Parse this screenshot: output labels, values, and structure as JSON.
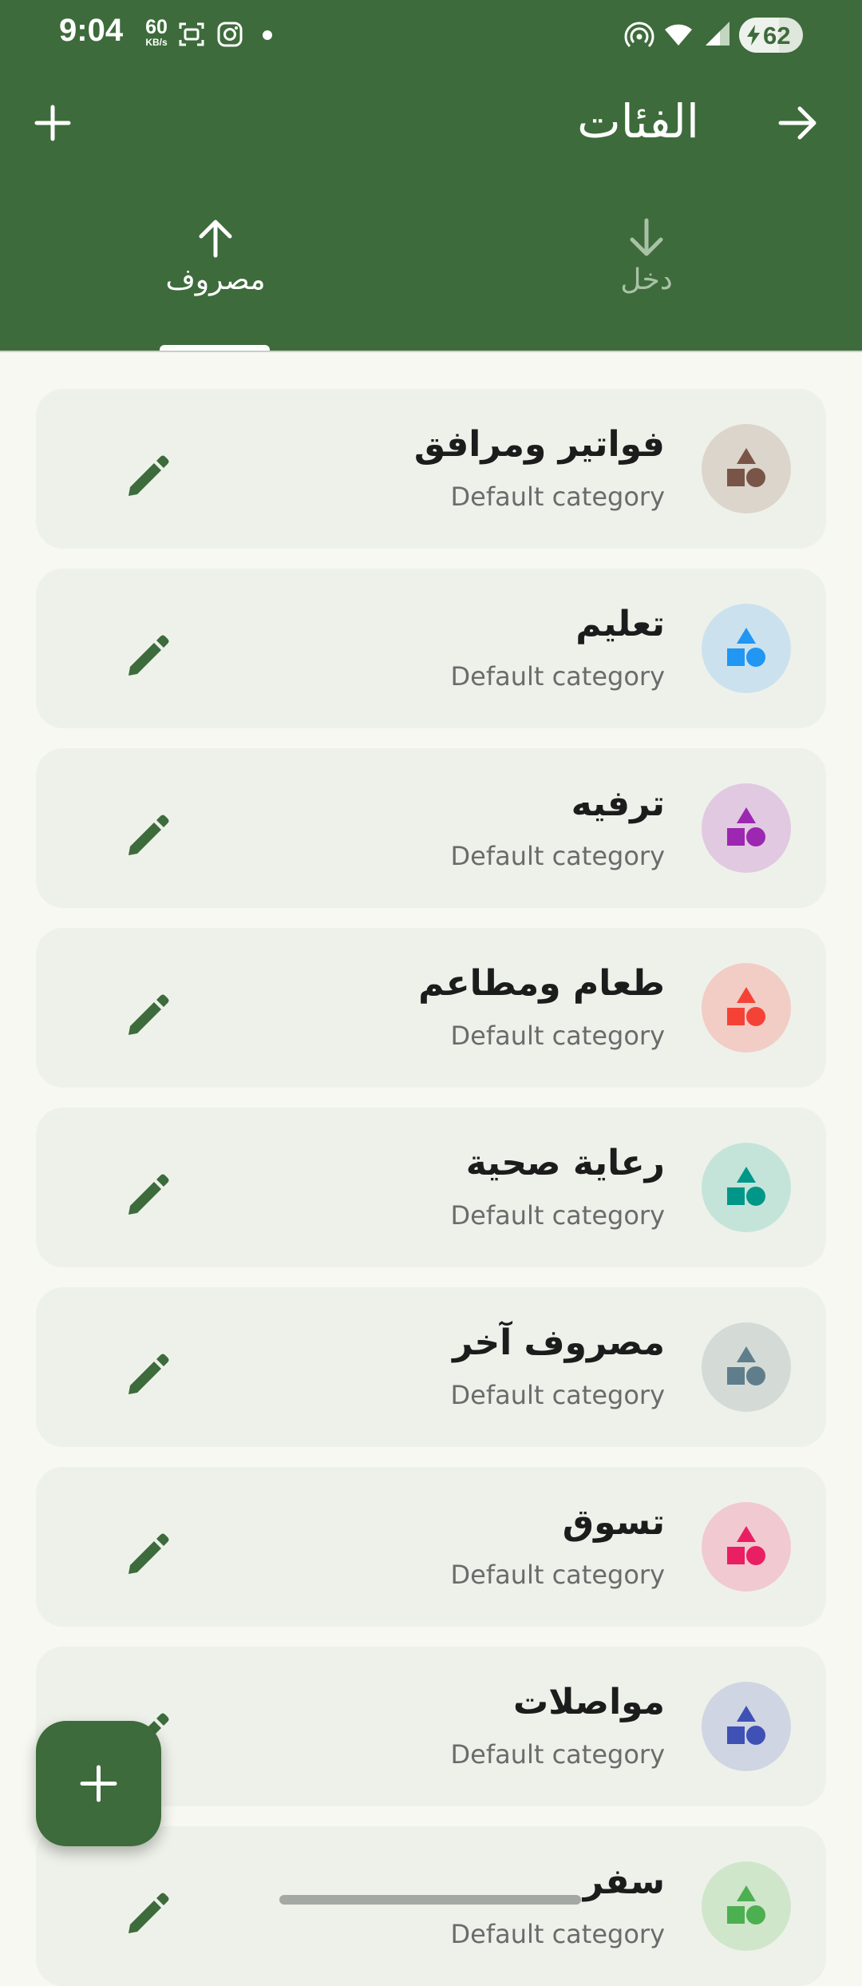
{
  "status_bar": {
    "time": "9:04",
    "net_speed_value": "60",
    "net_speed_unit": "KB/s",
    "battery_level": "62",
    "icons": [
      "screenshot-icon",
      "instagram-icon",
      "notification-dot",
      "hotspot-icon",
      "wifi-icon",
      "signal-icon",
      "battery-charging-icon"
    ]
  },
  "toolbar": {
    "title": "الفئات",
    "back_icon": "arrow-forward-icon",
    "add_icon": "plus-icon"
  },
  "tabs": [
    {
      "label": "مصروف",
      "icon": "arrow-up-icon",
      "selected": true
    },
    {
      "label": "دخل",
      "icon": "arrow-down-icon",
      "selected": false
    }
  ],
  "categories": [
    {
      "name": "فواتير ومرافق",
      "subtitle": "Default category",
      "color": "#795548",
      "bg": "#dcd5cc"
    },
    {
      "name": "تعليم",
      "subtitle": "Default category",
      "color": "#2196f3",
      "bg": "#cbe2ee"
    },
    {
      "name": "ترفيه",
      "subtitle": "Default category",
      "color": "#9c27b0",
      "bg": "#e1c9e1"
    },
    {
      "name": "طعام ومطاعم",
      "subtitle": "Default category",
      "color": "#f44336",
      "bg": "#f1cdc6"
    },
    {
      "name": "رعاية صحية",
      "subtitle": "Default category",
      "color": "#009688",
      "bg": "#c4e4da"
    },
    {
      "name": "مصروف آخر",
      "subtitle": "Default category",
      "color": "#607d8b",
      "bg": "#d4dbd6"
    },
    {
      "name": "تسوق",
      "subtitle": "Default category",
      "color": "#e91e63",
      "bg": "#f1c9d1"
    },
    {
      "name": "مواصلات",
      "subtitle": "Default category",
      "color": "#3f51b5",
      "bg": "#cfd5e2"
    },
    {
      "name": "سفر",
      "subtitle": "Default category",
      "color": "#4caf50",
      "bg": "#cfe6cb"
    }
  ],
  "fab": {
    "icon": "plus-icon"
  },
  "colors": {
    "primary": "#3d6b3b",
    "background": "#f6f8f1",
    "card": "#eef1ea"
  }
}
